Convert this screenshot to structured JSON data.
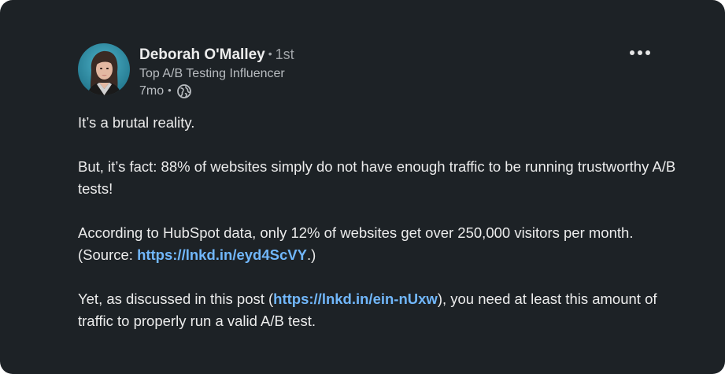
{
  "author": {
    "name": "Deborah O'Malley",
    "separator": "•",
    "degree": "1st",
    "headline": "Top A/B Testing Influencer",
    "time_ago": "7mo",
    "meta_separator": "•",
    "visibility_icon": "globe-icon",
    "avatar_icon": "profile-photo"
  },
  "menu": {
    "icon": "more-horizontal-icon"
  },
  "post": {
    "p1": "It’s a brutal reality.",
    "p2": "But, it’s fact: 88% of websites simply do not have enough traffic to be running trustworthy A/B tests!",
    "p3_before": "According to HubSpot data, only 12% of websites get over 250,000 visitors per month. (Source: ",
    "p3_link": "https://lnkd.in/eyd4ScVY",
    "p3_after": ".)",
    "p4_before": "Yet, as discussed in this post (",
    "p4_link": "https://lnkd.in/ein-nUxw",
    "p4_after": "), you need at least this amount of traffic to properly run a valid A/B test."
  },
  "colors": {
    "background": "#1d2226",
    "text": "#ececec",
    "muted": "#b8bcc0",
    "link": "#71b7fb"
  }
}
